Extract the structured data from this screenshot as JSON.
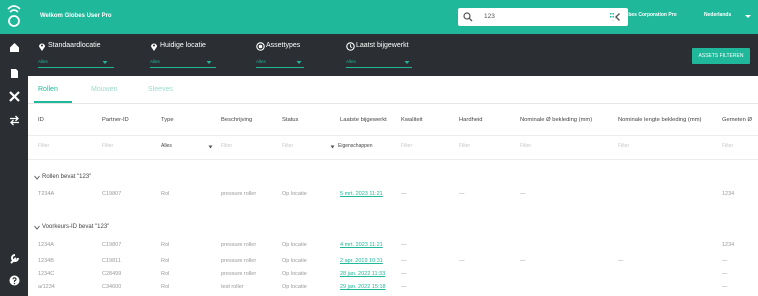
{
  "header": {
    "app_title": "Welkom Globes User Pro",
    "search_value": "123",
    "organization": "Globes Corporation Pro",
    "language": "Nederlands"
  },
  "filters": {
    "items": [
      {
        "label": "Standaardlocatie",
        "value": "Alles"
      },
      {
        "label": "Huidige locatie",
        "value": "Alles"
      },
      {
        "label": "Assettypes",
        "value": "Alles"
      },
      {
        "label": "Laatst bijgewerkt",
        "value": "Alles"
      }
    ],
    "button_label": "ASSETS FILTEREN"
  },
  "tabs": [
    "Rollen",
    "Mouwen",
    "Sleeves"
  ],
  "table": {
    "columns": [
      "ID",
      "Partner-ID",
      "Type",
      "Beschrijving",
      "Status",
      "Laatste bijgewerkt",
      "Kwaliteit",
      "Hardheid",
      "Nominale Ø bekleding (mm)",
      "Nominale lengte bekleding (mm)",
      "Gemeten Ø"
    ],
    "filter_placeholders": {
      "id": "Filter",
      "partner": "Filter",
      "type": "Alles",
      "type_filter": "Filter",
      "description": "Filter",
      "status": "Filter",
      "updated": "Eigenschappen",
      "quality": "Filter",
      "hardness": "Filter",
      "diameter": "Filter",
      "length": "Filter",
      "measured": "Filter"
    }
  },
  "section_1": {
    "title": "Rollen bevat \"123\"",
    "rows": [
      {
        "id": "T234A",
        "partner": "C19807",
        "type": "Rol",
        "description": "pressure roller",
        "status": "Op locatie",
        "updated": "5 mrt. 2023 11:21",
        "quality": "—",
        "hardness": "—",
        "diameter": "—",
        "length": "",
        "measured": "1234"
      }
    ]
  },
  "section_2": {
    "title": "Voorkeurs-ID bevat \"123\"",
    "rows": [
      {
        "id": "1234A",
        "partner": "C19807",
        "type": "Rol",
        "description": "pressure roller",
        "status": "Op locatie",
        "updated": "4 mrt. 2023 11:21",
        "quality": "—",
        "hardness": "",
        "diameter": "",
        "length": "",
        "measured": "1234"
      },
      {
        "id": "1234B",
        "partner": "C19811",
        "type": "Rol",
        "description": "pressure roller",
        "status": "Op locatie",
        "updated": "2 apr. 2019 10:31",
        "quality": "—",
        "hardness": "—",
        "diameter": "—",
        "length": "—",
        "measured": "—"
      },
      {
        "id": "1234C",
        "partner": "C28499",
        "type": "Rol",
        "description": "pressure roller",
        "status": "Op locatie",
        "updated": "28 jan. 2022 11:33",
        "quality": "—",
        "hardness": "",
        "diameter": "",
        "length": "",
        "measured": "—"
      },
      {
        "id": "a/1234",
        "partner": "C34600",
        "type": "Rol",
        "description": "test roller",
        "status": "Op locatie",
        "updated": "29 jan. 2022 15:18",
        "quality": "—",
        "hardness": "",
        "diameter": "",
        "length": "",
        "measured": "—"
      }
    ]
  },
  "colors": {
    "accent": "#1fb89a",
    "dark": "#2b2f33"
  },
  "icons": [
    "globes-logo",
    "home-icon",
    "asset-icon",
    "tools-icon",
    "swap-icon",
    "wrench-icon",
    "help-icon",
    "search-icon",
    "close-icon",
    "building-icon",
    "chevron-down-icon"
  ]
}
